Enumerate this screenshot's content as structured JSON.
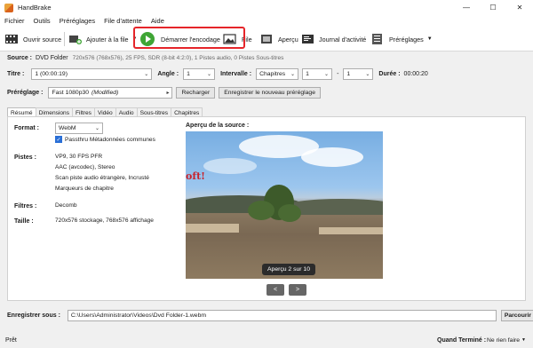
{
  "window": {
    "title": "HandBrake",
    "minimize": "—",
    "maximize": "☐",
    "close": "✕"
  },
  "menu": [
    "Fichier",
    "Outils",
    "Préréglages",
    "File d'attente",
    "Aide"
  ],
  "toolbar": {
    "open_source": "Ouvrir source",
    "add_to_queue": "Ajouter à la file",
    "start_encode": "Démarrer l'encodage",
    "queue": "File",
    "preview": "Aperçu",
    "activity_log": "Journal d'activité",
    "presets": "Préréglages"
  },
  "source": {
    "label": "Source :",
    "name": "DVD Folder",
    "info": "720x576 (768x576), 25 FPS, SDR (8-bit 4:2:0), 1 Pistes audio, 0 Pistes Sous-titres"
  },
  "title_row": {
    "title_label": "Titre :",
    "title_value": "1 (00:00:19)",
    "angle_label": "Angle :",
    "angle_value": "1",
    "range_label": "Intervalle :",
    "range_type": "Chapitres",
    "range_start": "1",
    "range_sep": "-",
    "range_end": "1",
    "duration_label": "Durée :",
    "duration_value": "00:00:20"
  },
  "preset_row": {
    "label": "Préréglage :",
    "value": "Fast 1080p30",
    "modified": "(Modified)",
    "reload": "Recharger",
    "save_new": "Enregistrer le nouveau préréglage"
  },
  "tabs": [
    "Résumé",
    "Dimensions",
    "Filtres",
    "Vidéo",
    "Audio",
    "Sous-titres",
    "Chapitres"
  ],
  "summary": {
    "format_label": "Format :",
    "format_value": "WebM",
    "passthru": "Passthru Métadonnées communes",
    "tracks_label": "Pistes :",
    "tracks": [
      "VP9, 30 FPS PFR",
      "AAC (avcodec), Stereo",
      "Scan piste audio étrangère, Incrusté",
      "Marqueurs de chapitre"
    ],
    "filters_label": "Filtres :",
    "filters_value": "Decomb",
    "size_label": "Taille :",
    "size_value": "720x576 stockage, 768x576 affichage"
  },
  "preview": {
    "label": "Aperçu de la source :",
    "overlay_text": "oft!",
    "counter": "Aperçu 2 sur 10",
    "prev": "<",
    "next": ">"
  },
  "save": {
    "label": "Enregistrer sous :",
    "path": "C:\\Users\\Administrator\\Videos\\Dvd Folder-1.webm",
    "browse": "Parcourir"
  },
  "status": {
    "text": "Prêt",
    "when_done_label": "Quand Terminé :",
    "when_done_value": "Ne rien faire"
  }
}
